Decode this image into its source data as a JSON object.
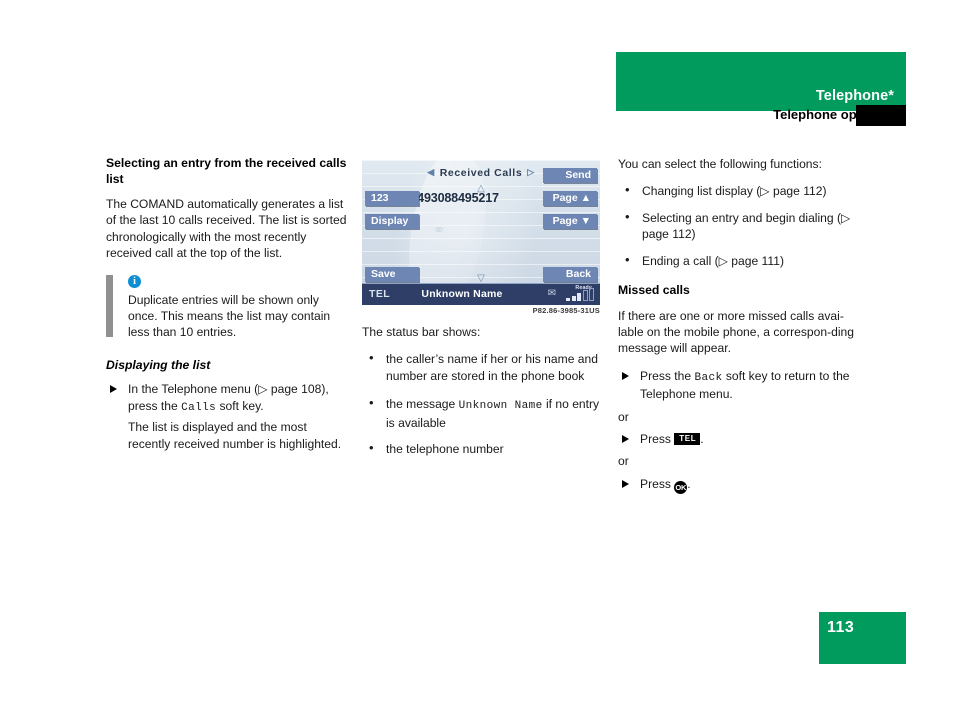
{
  "header": {
    "chapter_title": "Telephone*",
    "section_title": "Telephone operation"
  },
  "footer": {
    "page_number": "113"
  },
  "colors": {
    "brand_green": "#009b5d",
    "info_blue": "#0d8fd4",
    "note_bar_gray": "#909090",
    "display_softkey": "#6e86b4",
    "display_statusbar": "#2e3e67"
  },
  "left_column": {
    "heading": "Selecting an entry from the received calls list",
    "intro": "The COMAND automatically generates a list of the last 10 calls received. The list is sorted chronologically with the most recently received call at the top of the list.",
    "note": {
      "icon": "info-icon",
      "text": "Duplicate entries will be shown only once. This means the list may contain less than 10 entries."
    },
    "subheading": "Displaying the list",
    "step": {
      "text_before": "In the Telephone menu (▷ page 108), press the ",
      "softkey": "Calls",
      "text_after": " soft key."
    },
    "step_result": "The list is displayed and the most recently received number is highlighted."
  },
  "comand_display": {
    "title": "Received Calls",
    "left_arrow": "◀",
    "right_arrow": "▷",
    "scroll_up": "△",
    "scroll_down": "▽",
    "phone_number": "+493088495217",
    "softkeys_left": [
      "123",
      "Display",
      "Save"
    ],
    "softkeys_right": [
      "Send",
      "Page ▲",
      "Page ▼"
    ],
    "softkey_back": "Back",
    "status_bar": {
      "mode": "TEL",
      "name": "Unknown Name",
      "message_icon": "envelope-icon",
      "signal_label": "Ready"
    },
    "caption": "P82.86-3985-31US"
  },
  "middle_column": {
    "intro": "The status bar shows:",
    "bullets": [
      {
        "before": "the caller’s name if her or his name and number are stored in the phone book",
        "mono": "",
        "after": ""
      },
      {
        "before": "the message ",
        "mono": "Unknown Name",
        "after": " if no entry is available"
      },
      {
        "before": "the telephone number",
        "mono": "",
        "after": ""
      }
    ]
  },
  "right_column": {
    "intro": "You can select the following functions:",
    "bullets": [
      "Changing list display (▷ page 112)",
      "Selecting an entry and begin dialing (▷ page 112)",
      "Ending a call (▷ page 111)"
    ],
    "heading": "Missed calls",
    "paragraph": "If there are one or more missed calls avai-lable on the mobile phone, a correspon-ding message will appear.",
    "step1": {
      "before": "Press the ",
      "softkey": "Back",
      "after": " soft key to return to the Telephone menu."
    },
    "or_1": "or",
    "step2": {
      "before": "Press ",
      "key": "TEL",
      "after": "."
    },
    "or_2": "or",
    "step3": {
      "before": "Press ",
      "key": "OK",
      "after": "."
    }
  }
}
